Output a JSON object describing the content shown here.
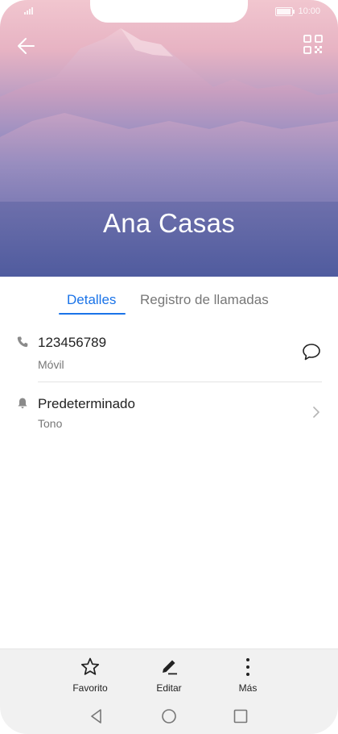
{
  "status": {
    "time": "10:00"
  },
  "contact": {
    "name": "Ana Casas"
  },
  "tabs": [
    {
      "label": "Detalles"
    },
    {
      "label": "Registro de llamadas"
    }
  ],
  "phone": {
    "number": "123456789",
    "type": "Móvil"
  },
  "ringtone": {
    "value": "Predeterminado",
    "label": "Tono"
  },
  "actions": [
    {
      "label": "Favorito"
    },
    {
      "label": "Editar"
    },
    {
      "label": "Más"
    }
  ],
  "colors": {
    "accent": "#1a73e8"
  },
  "icons": {
    "back": "arrow-left-icon",
    "qr": "qr-code-icon",
    "phone": "phone-icon",
    "message": "message-bubble-icon",
    "bell": "bell-icon",
    "chevron": "chevron-right-icon",
    "favorite": "star-outline-icon",
    "edit": "pencil-icon",
    "more": "more-vertical-icon"
  }
}
